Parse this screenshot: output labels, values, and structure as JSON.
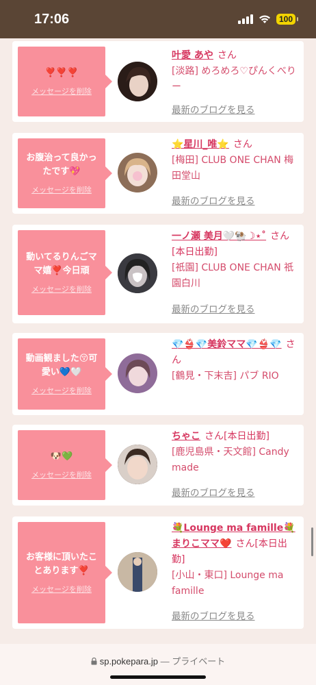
{
  "status": {
    "time": "17:06",
    "battery": "100"
  },
  "messages": [
    {
      "message": "❣️❣️❣️",
      "delete_label": "メッセージを削除",
      "name": "叶愛 あや",
      "san": "さん",
      "shop": "[淡路] めろめろ♡ぴんくべりー",
      "blog": "最新のブログを見る",
      "avatar_color": "#3a2a26"
    },
    {
      "message": "お腹治って良かったです💖",
      "delete_label": "メッセージを削除",
      "name": "⭐️星川_唯⭐️",
      "san": "さん",
      "shop": "[梅田] CLUB ONE CHAN 梅田堂山",
      "blog": "最新のブログを見る",
      "avatar_color": "#c9a98d"
    },
    {
      "message": "動いてるりんごママ嬉❣️今日頑",
      "delete_label": "メッセージを削除",
      "name": "一ノ瀬 美月🤍🐏☽⋆˚",
      "san": "さん[本日出勤]",
      "shop": "[祇園] CLUB ONE CHAN 祇園白川",
      "blog": "最新のブログを見る",
      "avatar_color": "#2b2b2e"
    },
    {
      "message": "動画観ました😚可愛い💙🤍",
      "delete_label": "メッセージを削除",
      "name": "💎👙💎美鈴ママ💎👙💎",
      "san": "さん",
      "shop": "[鶴見・下末吉] パブ RIO",
      "blog": "",
      "avatar_color": "#b78fb0"
    },
    {
      "message": "🐶💚",
      "delete_label": "メッセージを削除",
      "name": "ちゃこ",
      "san": "さん[本日出勤]",
      "shop": "[鹿児島県・天文館] Candy made",
      "blog": "最新のブログを見る",
      "avatar_color": "#4a3a30"
    },
    {
      "message": "お客様に頂いたことあります❣️",
      "delete_label": "メッセージを削除",
      "name": "💐Lounge ma famille💐 まりこママ❤️",
      "san": "さん[本日出勤]",
      "shop": "[小山・東口] Lounge ma famille",
      "blog": "最新のブログを見る",
      "avatar_color": "#8a7260"
    }
  ],
  "url_bar": {
    "domain": "sp.pokepara.jp",
    "separator": "—",
    "private_label": "プライベート"
  }
}
